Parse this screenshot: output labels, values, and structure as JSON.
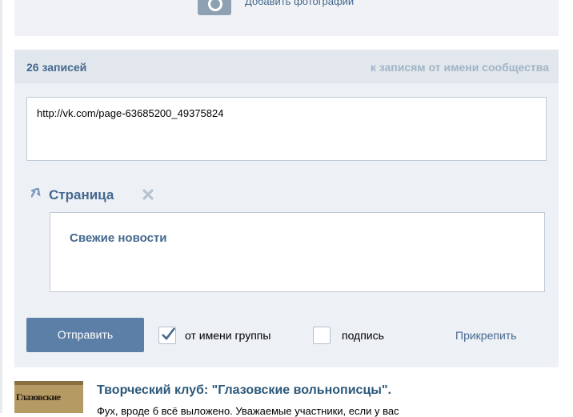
{
  "photo": {
    "add_label": "Добавить фотографии"
  },
  "composer": {
    "count": "26 записей",
    "as_community": "к записям от имени сообщества",
    "url_value": "http://vk.com/page-63685200_49375824",
    "attached_type": "Страница",
    "attached_title": "Свежие новости",
    "send_label": "Отправить",
    "from_group_label": "от имени группы",
    "from_group_checked": true,
    "signature_label": "подпись",
    "signature_checked": false,
    "attach_label": "Прикрепить"
  },
  "post": {
    "logo_text": "Глазовские",
    "title": "Творческий клуб: \"Глазовские вольнописцы\".",
    "text": "Фух, вроде б всё выложено. Уважаемые участники, если у вас"
  },
  "colors": {
    "link": "#45688e",
    "button": "#5b7fa6",
    "panel": "#edf1f5",
    "header": "#e1e7ed"
  }
}
